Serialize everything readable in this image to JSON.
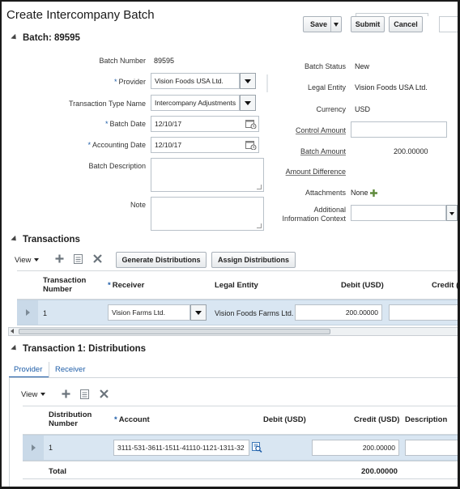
{
  "page": {
    "title": "Create Intercompany Batch"
  },
  "actions": {
    "save_label": "Save",
    "submit_label": "Submit",
    "cancel_label": "Cancel"
  },
  "batch": {
    "section_title": "Batch: 89595",
    "batch_number_label": "Batch Number",
    "batch_number": "89595",
    "provider_label": "Provider",
    "provider": "Vision Foods USA Ltd.",
    "transaction_type_label": "Transaction Type Name",
    "transaction_type": "Intercompany Adjustments",
    "batch_date_label": "Batch Date",
    "batch_date": "12/10/17",
    "accounting_date_label": "Accounting Date",
    "accounting_date": "12/10/17",
    "batch_description_label": "Batch Description",
    "note_label": "Note",
    "batch_status_label": "Batch Status",
    "batch_status": "New",
    "legal_entity_label": "Legal Entity",
    "legal_entity": "Vision Foods USA Ltd.",
    "currency_label": "Currency",
    "currency": "USD",
    "control_amount_label": "Control Amount",
    "batch_amount_label": "Batch Amount",
    "batch_amount": "200.00000",
    "amount_difference_label": "Amount Difference",
    "attachments_label": "Attachments",
    "attachments_value": "None",
    "additional_info_label_1": "Additional",
    "additional_info_label_2": "Information Context"
  },
  "transactions": {
    "section_title": "Transactions",
    "view_label": "View",
    "generate_btn": "Generate Distributions",
    "assign_btn": "Assign Distributions",
    "columns": {
      "txn_number_1": "Transaction",
      "txn_number_2": "Number",
      "receiver": "Receiver",
      "legal_entity": "Legal Entity",
      "debit": "Debit (USD)",
      "credit": "Credit ("
    },
    "rows": [
      {
        "number": "1",
        "receiver": "Vision Farms Ltd.",
        "legal_entity": "Vision Foods Farms Ltd.",
        "debit": "200.00000"
      }
    ]
  },
  "distributions": {
    "section_title": "Transaction 1: Distributions",
    "tabs": [
      "Provider",
      "Receiver"
    ],
    "view_label": "View",
    "columns": {
      "dist_number_1": "Distribution",
      "dist_number_2": "Number",
      "account": "Account",
      "debit": "Debit (USD)",
      "credit": "Credit (USD)",
      "description": "Description"
    },
    "rows": [
      {
        "number": "1",
        "account": "3111-531-3611-1511-41110-1121-1311-32",
        "credit": "200.00000"
      }
    ],
    "total_label": "Total",
    "total_credit": "200.00000"
  },
  "colors": {
    "required": "#1f5ea8",
    "selected_row": "#d9e6f2"
  },
  "icons": [
    "calendar-icon",
    "add-icon",
    "freeze-icon",
    "delete-icon",
    "search-icon",
    "dropdown-icon"
  ]
}
